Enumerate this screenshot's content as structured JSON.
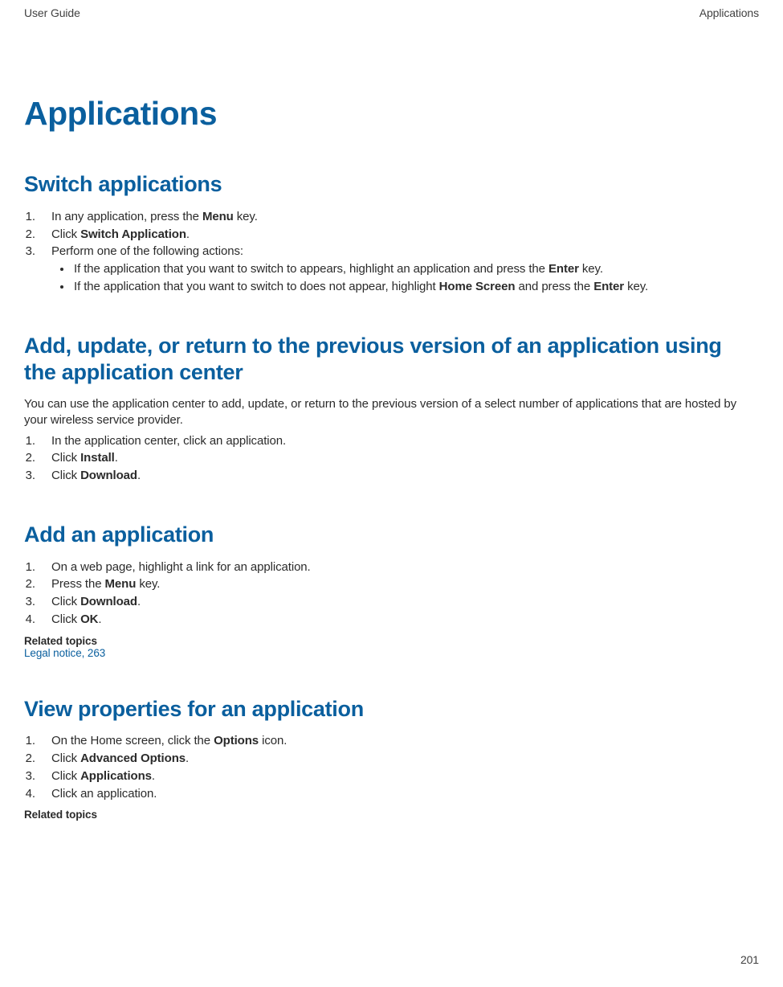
{
  "header": {
    "left": "User Guide",
    "right": "Applications"
  },
  "page_title": "Applications",
  "sections": {
    "switch": {
      "heading": "Switch applications",
      "step1_pre": "In any application, press the ",
      "step1_b": "Menu",
      "step1_post": " key.",
      "step2_pre": "Click ",
      "step2_b": "Switch Application",
      "step2_post": ".",
      "step3": "Perform one of the following actions:",
      "b1_pre": "If the application that you want to switch to appears, highlight an application and press the ",
      "b1_b": "Enter",
      "b1_post": " key.",
      "b2_pre": "If the application that you want to switch to does not appear, highlight ",
      "b2_b1": "Home Screen",
      "b2_mid": " and press the ",
      "b2_b2": "Enter",
      "b2_post": " key."
    },
    "appcenter": {
      "heading": "Add, update, or return to the previous version of an application using the application center",
      "intro": "You can use the application center to add, update, or return to the previous version of a select number of applications that are hosted by your wireless service provider.",
      "s1": "In the application center, click an application.",
      "s2_pre": "Click ",
      "s2_b": "Install",
      "s2_post": ".",
      "s3_pre": "Click ",
      "s3_b": "Download",
      "s3_post": "."
    },
    "addapp": {
      "heading": "Add an application",
      "s1": "On a web page, highlight a link for an application.",
      "s2_pre": "Press the ",
      "s2_b": "Menu",
      "s2_post": " key.",
      "s3_pre": "Click ",
      "s3_b": "Download",
      "s3_post": ".",
      "s4_pre": "Click ",
      "s4_b": "OK",
      "s4_post": ".",
      "related_label": "Related topics",
      "related_link": "Legal notice, 263"
    },
    "viewprops": {
      "heading": "View properties for an application",
      "s1_pre": "On the Home screen, click the ",
      "s1_b": "Options",
      "s1_post": " icon.",
      "s2_pre": "Click ",
      "s2_b": "Advanced Options",
      "s2_post": ".",
      "s3_pre": "Click ",
      "s3_b": "Applications",
      "s3_post": ".",
      "s4": "Click an application.",
      "related_label": "Related topics"
    }
  },
  "page_number": "201"
}
